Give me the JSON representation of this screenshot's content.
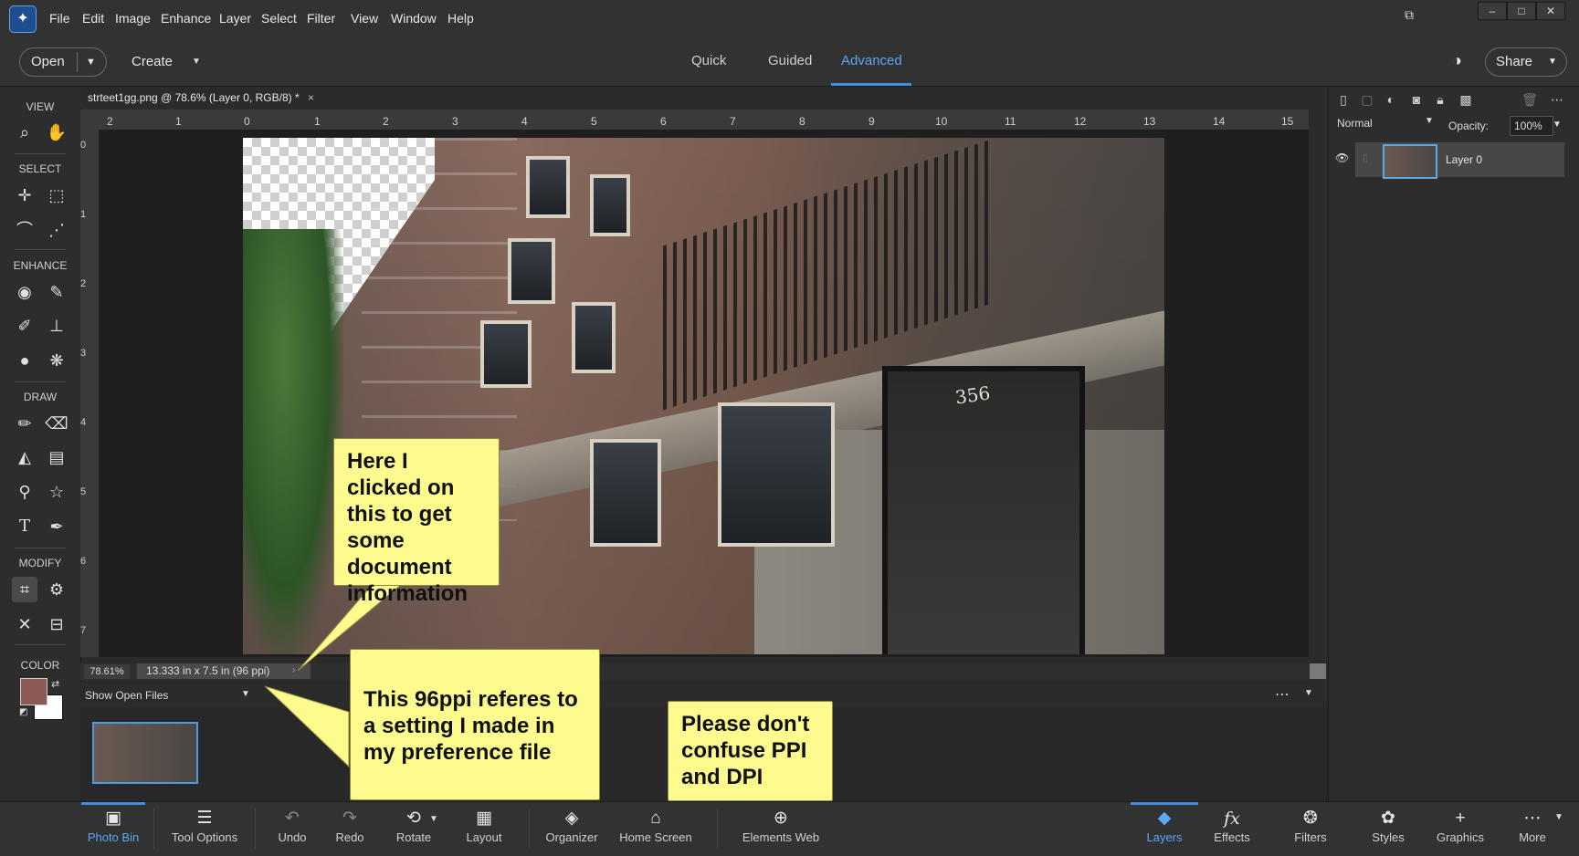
{
  "menu": [
    "File",
    "Edit",
    "Image",
    "Enhance",
    "Layer",
    "Select",
    "Filter",
    "View",
    "Window",
    "Help"
  ],
  "window_buttons": [
    "–",
    "□",
    "✕"
  ],
  "modebar": {
    "open": "Open",
    "create": "Create",
    "tabs": [
      "Quick",
      "Guided",
      "Advanced"
    ],
    "active_tab": "Advanced",
    "share": "Share"
  },
  "document": {
    "tab_title": "strteet1gg.png @ 78.6% (Layer 0, RGB/8) *",
    "close": "×",
    "house_number": "356"
  },
  "ruler": {
    "h": [
      "2",
      "1",
      "0",
      "1",
      "2",
      "3",
      "4",
      "5",
      "6",
      "7",
      "8",
      "9",
      "10",
      "11",
      "12",
      "13",
      "14",
      "15"
    ],
    "v": [
      "0",
      "1",
      "2",
      "3",
      "4",
      "5",
      "6",
      "7"
    ]
  },
  "status": {
    "zoom": "78.61%",
    "info": "13.333 in x 7.5 in (96 ppi)"
  },
  "toolbar": {
    "sections": [
      "VIEW",
      "SELECT",
      "ENHANCE",
      "DRAW",
      "MODIFY",
      "COLOR"
    ],
    "fg_color": "#8b5a55",
    "bg_color": "#ffffff"
  },
  "layers": {
    "blend_mode": "Normal",
    "opacity_label": "Opacity:",
    "opacity_value": "100%",
    "layer_name": "Layer 0"
  },
  "photo_bin": {
    "show_label": "Show Open Files"
  },
  "bottombar": {
    "left": [
      {
        "label": "Photo Bin",
        "icon": "▣"
      },
      {
        "label": "Tool Options",
        "icon": "☰"
      },
      {
        "label": "Undo",
        "icon": "↶"
      },
      {
        "label": "Redo",
        "icon": "↷"
      },
      {
        "label": "Rotate",
        "icon": "⟲"
      },
      {
        "label": "Layout",
        "icon": "▦"
      },
      {
        "label": "Organizer",
        "icon": "◈"
      },
      {
        "label": "Home Screen",
        "icon": "⌂"
      },
      {
        "label": "Elements Web",
        "icon": "⊕"
      }
    ],
    "right": [
      {
        "label": "Layers",
        "icon": "◆"
      },
      {
        "label": "Effects",
        "icon": "fx"
      },
      {
        "label": "Filters",
        "icon": "❂"
      },
      {
        "label": "Styles",
        "icon": "✿"
      },
      {
        "label": "Graphics",
        "icon": "+"
      },
      {
        "label": "More",
        "icon": "⋯"
      }
    ]
  },
  "callouts": {
    "one": "Here I clicked on this to get some document information",
    "two": "This 96ppi referes to a setting I made in my preference file",
    "three": "Please don't confuse PPI and DPI"
  },
  "colors": {
    "accent": "#3f8fe6",
    "callout_bg": "#fdfb8e"
  }
}
